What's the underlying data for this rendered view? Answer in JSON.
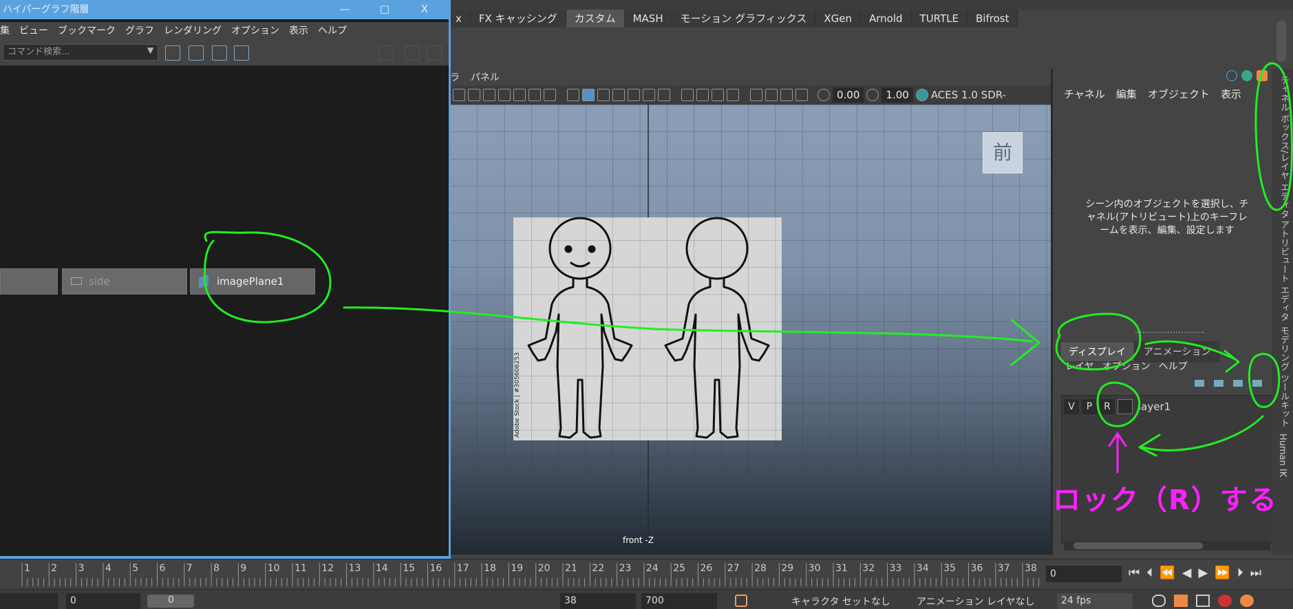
{
  "shelf": {
    "tabs": [
      "x",
      "FX キャッシング",
      "カスタム",
      "MASH",
      "モーション グラフィックス",
      "XGen",
      "Arnold",
      "TURTLE",
      "Bifrost"
    ],
    "active_tab": "カスタム"
  },
  "hypergraph": {
    "title": "ハイパーグラフ階層",
    "menu": [
      "集",
      "ビュー",
      "ブックマーク",
      "グラフ",
      "レンダリング",
      "オプション",
      "表示",
      "ヘルプ"
    ],
    "search_placeholder": "コマンド検索...",
    "nodes": [
      "",
      "side",
      "imagePlane1"
    ],
    "window_buttons": {
      "minimize": "—",
      "maximize": "□",
      "close": "X"
    }
  },
  "viewport": {
    "menu": [
      "ラ",
      "パネル"
    ],
    "near_clip": "0.00",
    "far_clip": "1.00",
    "color_space": "ACES 1.0 SDR-",
    "view_badge": "前",
    "camera_label": "front -Z",
    "watermark": "Adobe Stock | #305606253"
  },
  "channel_box": {
    "menu": [
      "チャネル",
      "編集",
      "オブジェクト",
      "表示"
    ],
    "message": "シーン内のオブジェクトを選択し、チャネル(アトリビュート)上のキーフレームを表示、編集、設定します"
  },
  "layer_editor": {
    "tabs": [
      "ディスプレイ",
      "アニメーション"
    ],
    "menu": [
      "レイヤ",
      "オプション",
      "ヘルプ"
    ],
    "layer": {
      "v": "V",
      "p": "P",
      "r": "R",
      "name": "layer1"
    }
  },
  "side_tabs": [
    "チャネル ボックス/レイヤ エディタ",
    "アトリビュート エディタ",
    "モデリング ツールキット",
    "Human IK"
  ],
  "timeline": {
    "ticks": [
      "1",
      "2",
      "3",
      "4",
      "5",
      "6",
      "7",
      "8",
      "9",
      "10",
      "11",
      "12",
      "13",
      "14",
      "15",
      "16",
      "17",
      "18",
      "19",
      "20",
      "21",
      "22",
      "23",
      "24",
      "25",
      "26",
      "27",
      "28",
      "29",
      "30",
      "31",
      "32",
      "33",
      "34",
      "35",
      "36",
      "37",
      "38"
    ],
    "current_frame": "0"
  },
  "range": {
    "start": "0",
    "start2": "0",
    "end": "38",
    "end2": "700",
    "character_set": "キャラクタ セットなし",
    "anim_layer": "アニメーション レイヤなし",
    "fps": "24 fps"
  },
  "annotation": {
    "text": "ロック（R）する",
    "colors": {
      "circle": "#22ee22",
      "text": "#ff20ff"
    }
  }
}
